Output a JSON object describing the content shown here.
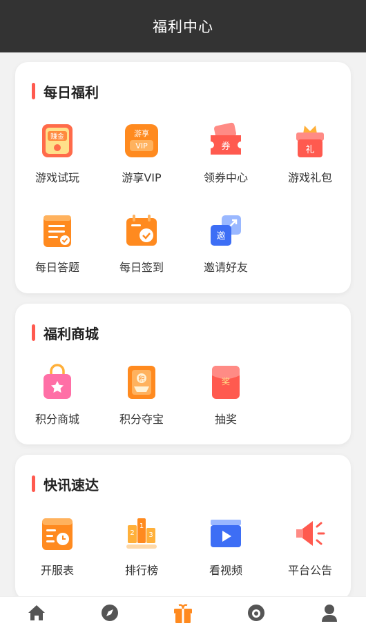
{
  "header": {
    "title": "福利中心"
  },
  "sections": [
    {
      "title": "每日福利",
      "items": [
        {
          "label": "游戏试玩",
          "icon": "game-trial-icon"
        },
        {
          "label": "游享VIP",
          "icon": "vip-icon"
        },
        {
          "label": "领券中心",
          "icon": "coupon-icon"
        },
        {
          "label": "游戏礼包",
          "icon": "gift-box-icon"
        },
        {
          "label": "每日答题",
          "icon": "quiz-icon"
        },
        {
          "label": "每日签到",
          "icon": "checkin-icon"
        },
        {
          "label": "邀请好友",
          "icon": "invite-icon"
        }
      ]
    },
    {
      "title": "福利商城",
      "items": [
        {
          "label": "积分商城",
          "icon": "shopping-bag-icon"
        },
        {
          "label": "积分夺宝",
          "icon": "treasure-icon"
        },
        {
          "label": "抽奖",
          "icon": "lottery-icon"
        }
      ]
    },
    {
      "title": "快讯速达",
      "items": [
        {
          "label": "开服表",
          "icon": "server-schedule-icon"
        },
        {
          "label": "排行榜",
          "icon": "ranking-icon"
        },
        {
          "label": "看视频",
          "icon": "video-icon"
        },
        {
          "label": "平台公告",
          "icon": "announcement-icon"
        }
      ]
    }
  ],
  "icon_text": {
    "game_trial": "赚金",
    "vip_top": "游享",
    "vip_bottom": "VIP",
    "coupon": "券",
    "gift": "礼",
    "invite": "邀",
    "treasure": "积",
    "lottery": "奖"
  },
  "bottom_nav": [
    {
      "icon": "home-icon",
      "active": false
    },
    {
      "icon": "compass-icon",
      "active": false
    },
    {
      "icon": "gift-icon",
      "active": true
    },
    {
      "icon": "coin-bag-icon",
      "active": false
    },
    {
      "icon": "user-icon",
      "active": false
    }
  ],
  "colors": {
    "topbar": "#333333",
    "accent_orange": "#ff8a1f",
    "accent_red": "#ff5a4f",
    "nav_icon": "#555555"
  }
}
